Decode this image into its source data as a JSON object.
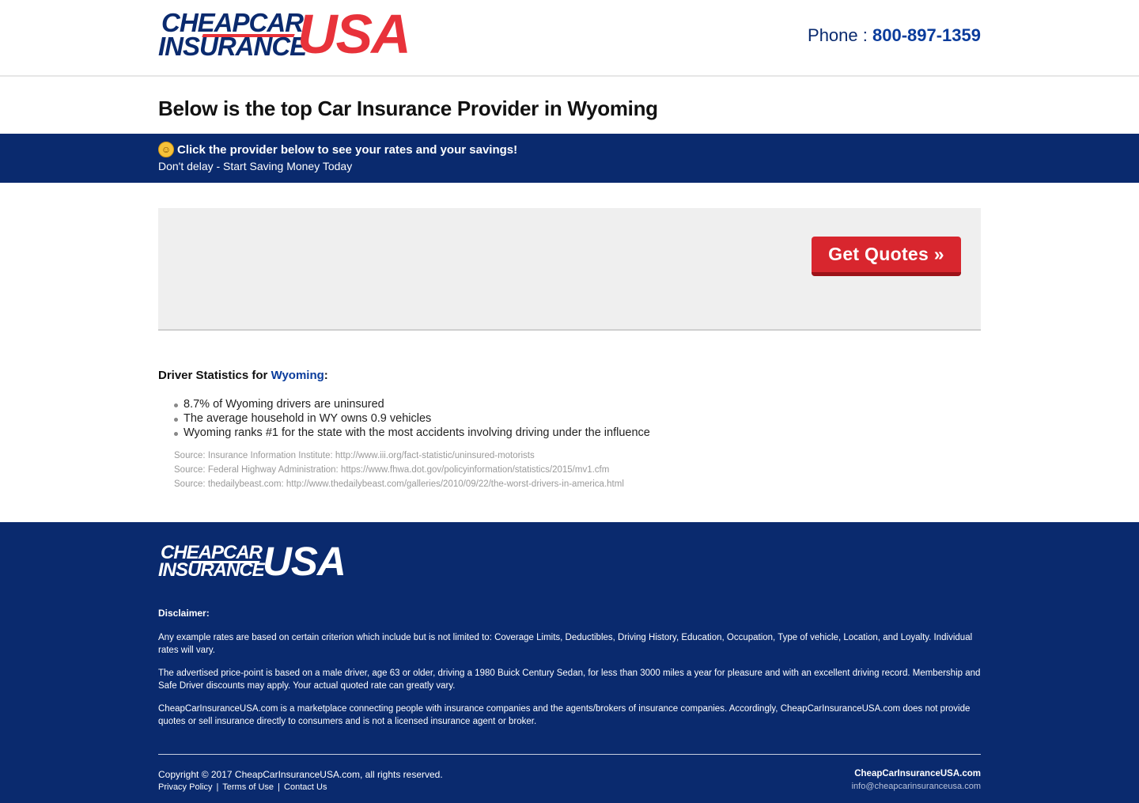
{
  "header": {
    "logo": {
      "line1": "CHEAPCAR",
      "line2": "INSURANCE",
      "usa": "USA"
    },
    "phone_label": "Phone :",
    "phone_number": "800-897-1359"
  },
  "main": {
    "heading": "Below is the top Car Insurance Provider in Wyoming"
  },
  "band": {
    "headline": "Click the provider below to see your rates and your savings!",
    "subline": "Don't delay - Start Saving Money Today",
    "emoji_icon": "hugging-face-emoji"
  },
  "provider_card": {
    "button_label": "Get Quotes »"
  },
  "stats": {
    "title_prefix": "Driver Statistics for",
    "state": "Wyoming",
    "title_suffix": ":",
    "items": [
      "8.7% of Wyoming drivers are uninsured",
      "The average household in WY owns 0.9 vehicles",
      "Wyoming ranks #1 for the state with the most accidents involving driving under the influence"
    ],
    "sources": [
      "Source: Insurance Information Institute: http://www.iii.org/fact-statistic/uninsured-motorists",
      "Source: Federal Highway Administration: https://www.fhwa.dot.gov/policyinformation/statistics/2015/mv1.cfm",
      "Source: thedailybeast.com: http://www.thedailybeast.com/galleries/2010/09/22/the-worst-drivers-in-america.html"
    ]
  },
  "footer": {
    "logo": {
      "line1": "CHEAPCAR",
      "line2": "INSURANCE",
      "usa": "USA"
    },
    "disclaimer_title": "Disclaimer:",
    "disclaimers": [
      "Any example rates are based on certain criterion which include but is not limited to: Coverage Limits, Deductibles, Driving History, Education, Occupation, Type of vehicle, Location, and Loyalty. Individual rates will vary.",
      "The advertised price-point is based on a male driver, age 63 or older, driving a 1980 Buick Century Sedan, for less than 3000 miles a year for pleasure and with an excellent driving record. Membership and Safe Driver discounts may apply. Your actual quoted rate can greatly vary.",
      "CheapCarInsuranceUSA.com is a marketplace connecting people with insurance companies and the agents/brokers of insurance companies. Accordingly, CheapCarInsuranceUSA.com does not provide quotes or sell insurance directly to consumers and is not a licensed insurance agent or broker."
    ],
    "copyright": "Copyright © 2017 CheapCarInsuranceUSA.com, all rights reserved.",
    "links": [
      "Privacy Policy",
      "Terms of Use",
      "Contact Us"
    ],
    "link_separator": "|",
    "site_name": "CheapCarInsuranceUSA.com",
    "email": "info@cheapcarinsuranceusa.com"
  },
  "colors": {
    "brand_navy": "#0a2a6e",
    "brand_red": "#e8323a",
    "button_red": "#d8262e",
    "link_blue": "#0a3c9c"
  }
}
